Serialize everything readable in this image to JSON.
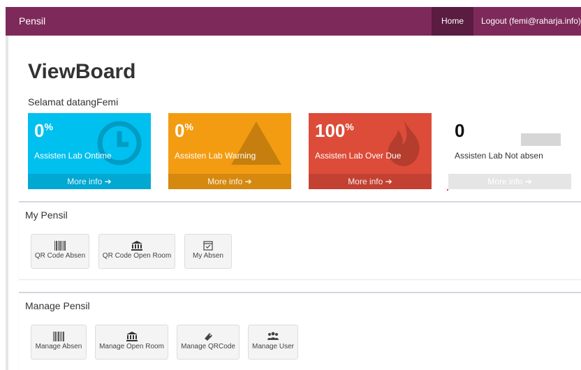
{
  "navbar": {
    "brand": "Pensil",
    "home": "Home",
    "logout": "Logout (femi@raharja.info)"
  },
  "page": {
    "title": "ViewBoard",
    "welcome": "Selamat datangFemi"
  },
  "stats": [
    {
      "value": "0",
      "unit": "%",
      "label": "Assisten Lab Ontime",
      "more": "More info",
      "color": "#00c0ef",
      "icon": "clock-icon"
    },
    {
      "value": "0",
      "unit": "%",
      "label": "Assisten Lab Warning",
      "more": "More info",
      "color": "#f39c12",
      "icon": "warning-icon"
    },
    {
      "value": "100",
      "unit": "%",
      "label": "Assisten Lab Over Due",
      "more": "More info",
      "color": "#dd4b39",
      "icon": "fire-icon"
    },
    {
      "value": "0",
      "label": "Assisten Lab Not absen",
      "more": "More info",
      "color": "#ffffff"
    }
  ],
  "my_pensil": {
    "title": "My Pensil",
    "buttons": [
      {
        "label": "QR Code Absen",
        "icon": "barcode-icon"
      },
      {
        "label": "QR Code Open Room",
        "icon": "bank-icon"
      },
      {
        "label": "My Absen",
        "icon": "calendar-check-icon"
      }
    ]
  },
  "manage_pensil": {
    "title": "Manage Pensil",
    "buttons": [
      {
        "label": "Manage Absen",
        "icon": "barcode-icon"
      },
      {
        "label": "Manage Open Room",
        "icon": "bank-icon"
      },
      {
        "label": "Manage QRCode",
        "icon": "tag-icon"
      },
      {
        "label": "Manage User",
        "icon": "users-icon"
      }
    ]
  }
}
